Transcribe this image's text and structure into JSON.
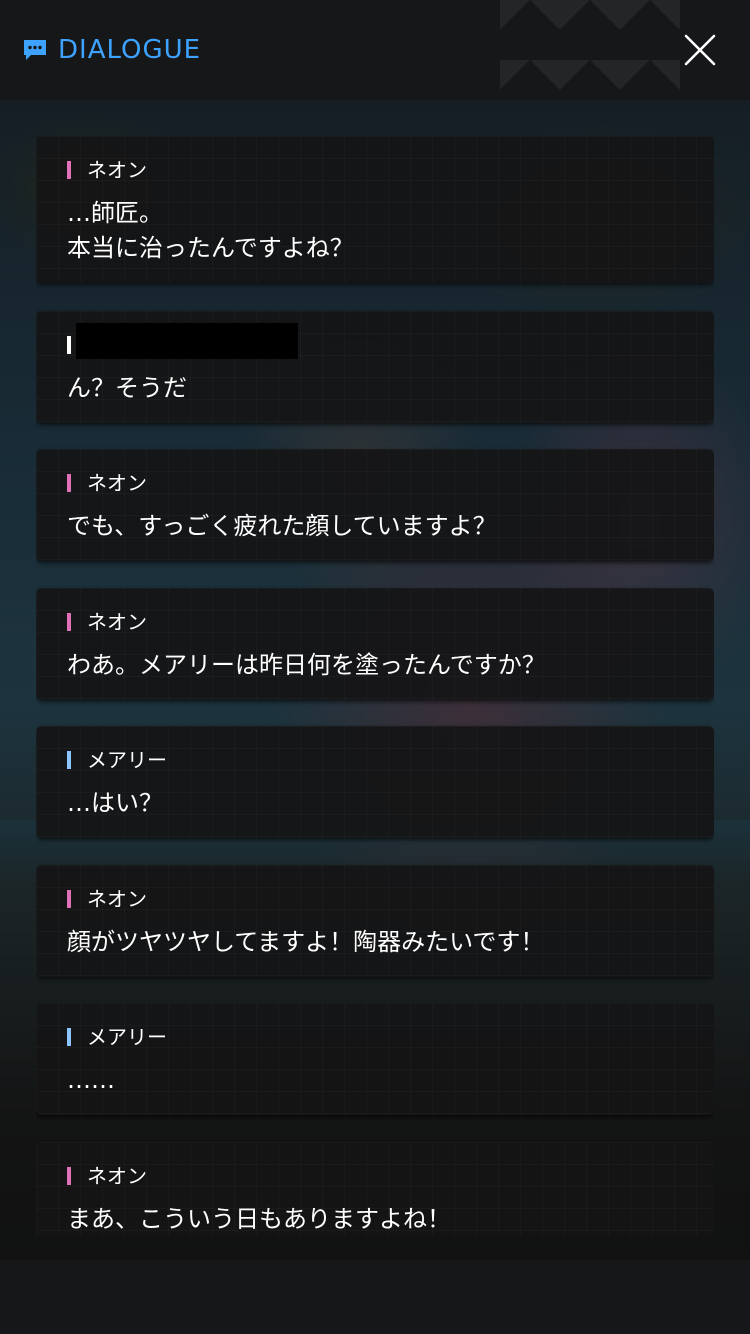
{
  "header": {
    "title": "DIALOGUE",
    "accent": "#3ea2ff",
    "icon": "chat-bubble-icon",
    "close_icon": "close-icon"
  },
  "colors": {
    "neon": "#e070b8",
    "mary": "#8cc4ff",
    "redacted": "#ffffff"
  },
  "messages": [
    {
      "speaker": "ネオン",
      "color_key": "neon",
      "lines": [
        "…師匠。",
        "本当に治ったんですよね？"
      ]
    },
    {
      "speaker": "",
      "color_key": "redacted",
      "redacted": true,
      "lines": [
        "ん？そうだ"
      ]
    },
    {
      "speaker": "ネオン",
      "color_key": "neon",
      "lines": [
        "でも、すっごく疲れた顔していますよ？"
      ]
    },
    {
      "speaker": "ネオン",
      "color_key": "neon",
      "lines": [
        "わあ。メアリーは昨日何を塗ったんですか？"
      ]
    },
    {
      "speaker": "メアリー",
      "color_key": "mary",
      "lines": [
        "…はい？"
      ]
    },
    {
      "speaker": "ネオン",
      "color_key": "neon",
      "lines": [
        "顔がツヤツヤしてますよ！陶器みたいです！"
      ]
    },
    {
      "speaker": "メアリー",
      "color_key": "mary",
      "lines": [
        "……"
      ]
    },
    {
      "speaker": "ネオン",
      "color_key": "neon",
      "lines": [
        "まあ、こういう日もありますよね！"
      ]
    }
  ]
}
